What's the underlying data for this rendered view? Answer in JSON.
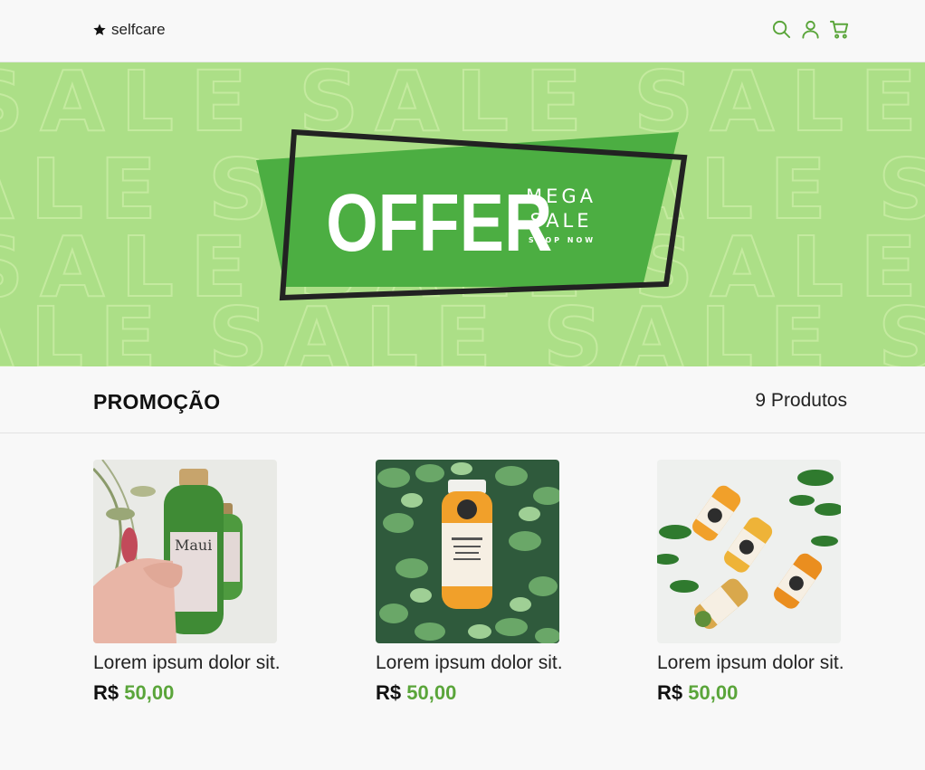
{
  "header": {
    "logo_text": "selfcare",
    "icons": [
      "star-icon",
      "search-icon",
      "user-icon",
      "cart-icon"
    ],
    "accent_color": "#5aa53a"
  },
  "banner": {
    "background_word": "SALE",
    "headline": "OFFER",
    "line1": "MEGA",
    "line2": "SALE",
    "cta": "SHOP NOW",
    "colors": {
      "background": "#acdf87",
      "panel": "#4cae42",
      "frame": "#222222"
    }
  },
  "section": {
    "title": "PROMOÇÃO",
    "count": "9 Produtos"
  },
  "products": [
    {
      "name": "Lorem ipsum dolor sit.",
      "currency": "R$",
      "price": "50,00"
    },
    {
      "name": "Lorem ipsum dolor sit.",
      "currency": "R$",
      "price": "50,00"
    },
    {
      "name": "Lorem ipsum dolor sit.",
      "currency": "R$",
      "price": "50,00"
    }
  ]
}
